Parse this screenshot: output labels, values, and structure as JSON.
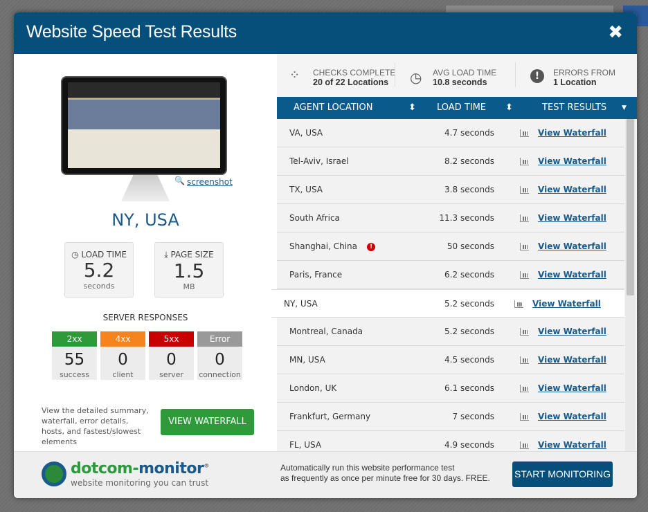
{
  "header": {
    "title": "Website Speed Test Results",
    "close_icon": "close-icon"
  },
  "left": {
    "screenshot_link": "screenshot",
    "location": "NY, USA",
    "load_time": {
      "label": "LOAD TIME",
      "value": "5.2",
      "unit": "seconds"
    },
    "page_size": {
      "label": "PAGE SIZE",
      "value": "1.5",
      "unit": "MB"
    },
    "server_responses_title": "SERVER RESPONSES",
    "responses": [
      {
        "code": "2xx",
        "count": "55",
        "label": "success",
        "color": "#2f9a3a"
      },
      {
        "code": "4xx",
        "count": "0",
        "label": "client",
        "color": "#f5841f"
      },
      {
        "code": "5xx",
        "count": "0",
        "label": "server",
        "color": "#c80000"
      },
      {
        "code": "Error",
        "count": "0",
        "label": "connection",
        "color": "#999999"
      }
    ],
    "description": "View the detailed summary, waterfall, error details, hosts, and fastest/slowest elements",
    "view_waterfall_button": "VIEW WATERFALL"
  },
  "stats": {
    "checks": {
      "label": "CHECKS COMPLETE",
      "value": "20 of 22 Locations"
    },
    "avg": {
      "label": "AVG LOAD TIME",
      "value": "10.8 seconds"
    },
    "errors": {
      "label": "ERRORS FROM",
      "value": "1 Location"
    }
  },
  "table": {
    "headers": [
      "AGENT LOCATION",
      "LOAD TIME",
      "TEST RESULTS"
    ],
    "link_label": "View Waterfall",
    "rows": [
      {
        "location": "VA, USA",
        "time": "4.7 seconds"
      },
      {
        "location": "Tel-Aviv, Israel",
        "time": "8.2 seconds"
      },
      {
        "location": "TX, USA",
        "time": "3.8 seconds"
      },
      {
        "location": "South Africa",
        "time": "11.3 seconds"
      },
      {
        "location": "Shanghai, China",
        "time": "50 seconds",
        "error": true
      },
      {
        "location": "Paris, France",
        "time": "6.2 seconds"
      },
      {
        "location": "NY, USA",
        "time": "5.2 seconds",
        "selected": true
      },
      {
        "location": "Montreal, Canada",
        "time": "5.2 seconds"
      },
      {
        "location": "MN, USA",
        "time": "4.5 seconds"
      },
      {
        "location": "London, UK",
        "time": "6.1 seconds"
      },
      {
        "location": "Frankfurt, Germany",
        "time": "7 seconds"
      },
      {
        "location": "FL, USA",
        "time": "4.9 seconds"
      }
    ]
  },
  "footer": {
    "logo_name": "dotcom-monitor",
    "logo_tagline": "website monitoring you can trust",
    "message_line1": "Automatically run this website performance test",
    "message_line2": "as frequently as once per minute free for 30 days. FREE.",
    "start_button": "START MONITORING"
  }
}
